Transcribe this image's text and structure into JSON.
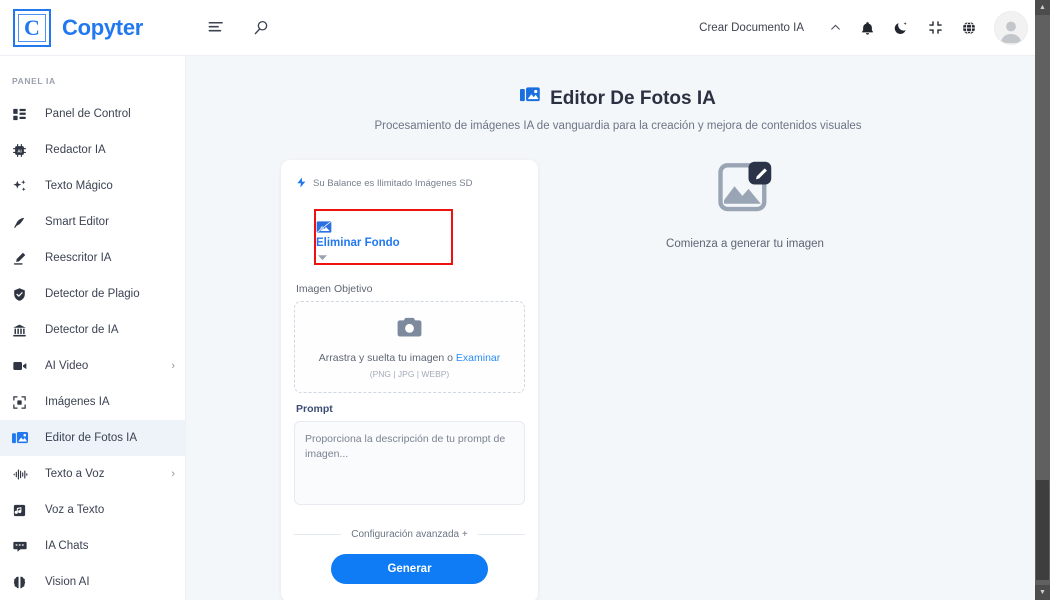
{
  "header": {
    "logo_letter": "C",
    "brand": "Copyter",
    "menu_icon": "list-menu-icon",
    "search_icon": "search-icon",
    "create_document": "Crear Documento IA",
    "chevron": "chevron-up-icon",
    "notification_icon": "bell-icon",
    "theme_icon": "moon-icon",
    "fullscreen_icon": "collapse-icon",
    "language_icon": "globe-icon",
    "avatar": "user-avatar"
  },
  "sidebar": {
    "section_label": "PANEL IA",
    "items": [
      {
        "label": "Panel de Control",
        "icon": "dashboard-icon",
        "arrow": "",
        "active": false
      },
      {
        "label": "Redactor IA",
        "icon": "chip-ai-icon",
        "arrow": "",
        "active": false
      },
      {
        "label": "Texto Mágico",
        "icon": "sparkles-icon",
        "arrow": "",
        "active": false
      },
      {
        "label": "Smart Editor",
        "icon": "feather-icon",
        "arrow": "",
        "active": false
      },
      {
        "label": "Reescritor IA",
        "icon": "pencil-icon",
        "arrow": "",
        "active": false
      },
      {
        "label": "Detector de Plagio",
        "icon": "shield-check-icon",
        "arrow": "",
        "active": false
      },
      {
        "label": "Detector de IA",
        "icon": "bank-icon",
        "arrow": "",
        "active": false
      },
      {
        "label": "AI Video",
        "icon": "video-camera-icon",
        "arrow": "›",
        "active": false
      },
      {
        "label": "Imágenes IA",
        "icon": "image-frame-icon",
        "arrow": "",
        "active": false
      },
      {
        "label": "Editor de Fotos IA",
        "icon": "photo-editor-icon",
        "arrow": "",
        "active": true
      },
      {
        "label": "Texto a Voz",
        "icon": "waveform-icon",
        "arrow": "›",
        "active": false
      },
      {
        "label": "Voz a Texto",
        "icon": "music-note-icon",
        "arrow": "",
        "active": false
      },
      {
        "label": "IA Chats",
        "icon": "chat-bubble-icon",
        "arrow": "",
        "active": false
      },
      {
        "label": "Vision AI",
        "icon": "brain-icon",
        "arrow": "",
        "active": false
      }
    ]
  },
  "main": {
    "title": "Editor De Fotos IA",
    "title_icon": "photo-editor-icon",
    "subtitle": "Procesamiento de imágenes IA de vanguardia para la creación y mejora de contenidos visuales"
  },
  "tool_card": {
    "balance_icon": "bolt-icon",
    "balance_text": "Su Balance es Ilimitado Imágenes SD",
    "mode": {
      "icon": "remove-background-icon",
      "label": "Eliminar Fondo",
      "chevron": "chevron-down-icon",
      "highlight_color": "#ef1010"
    },
    "target_image": {
      "label": "Imagen Objetivo",
      "icon": "camera-icon",
      "drop_text": "Arrastra y suelta tu imagen o ",
      "browse_link": "Examinar",
      "formats": "(PNG | JPG | WEBP)"
    },
    "prompt": {
      "label": "Prompt",
      "placeholder": "Proporciona la descripción de tu prompt de imagen...",
      "value": ""
    },
    "advanced_label": "Configuración avanzada +",
    "generate_label": "Generar",
    "generate_color": "#0f7bf4"
  },
  "preview": {
    "icon": "image-edit-placeholder-icon",
    "text": "Comienza a generar tu imagen"
  },
  "scrollbar": {
    "up_arrow": "▲",
    "down_arrow": "▼"
  },
  "colors": {
    "brand_blue": "#2279ef",
    "main_bg": "#f4f7fa",
    "active_nav": "#eef3f9"
  }
}
